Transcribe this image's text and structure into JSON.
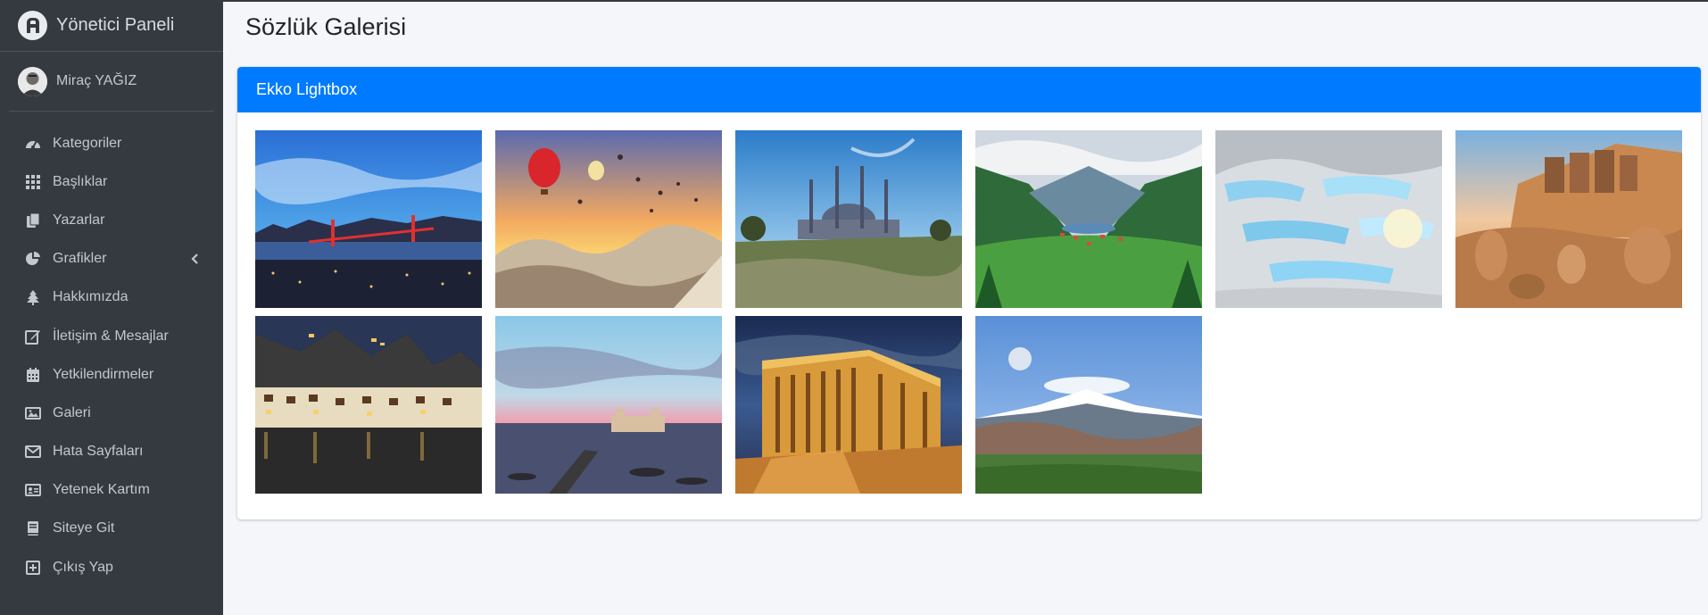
{
  "brand": {
    "title": "Yönetici Paneli"
  },
  "user": {
    "name": "Miraç YAĞIZ"
  },
  "sidebar": {
    "items": [
      {
        "label": "Kategoriler",
        "icon": "tachometer-icon"
      },
      {
        "label": "Başlıklar",
        "icon": "grid-icon"
      },
      {
        "label": "Yazarlar",
        "icon": "copy-icon"
      },
      {
        "label": "Grafikler",
        "icon": "pie-chart-icon",
        "has_arrow": true
      },
      {
        "label": "Hakkımızda",
        "icon": "tree-icon"
      },
      {
        "label": "İletişim & Mesajlar",
        "icon": "edit-icon"
      },
      {
        "label": "Yetkilendirmeler",
        "icon": "calendar-icon"
      },
      {
        "label": "Galeri",
        "icon": "image-icon"
      },
      {
        "label": "Hata Sayfaları",
        "icon": "envelope-icon"
      },
      {
        "label": "Yetenek Kartım",
        "icon": "id-card-icon"
      },
      {
        "label": "Siteye Git",
        "icon": "book-icon"
      },
      {
        "label": "Çıkış Yap",
        "icon": "plus-square-icon"
      }
    ]
  },
  "page": {
    "title": "Sözlük Galerisi"
  },
  "card": {
    "title": "Ekko Lightbox"
  },
  "gallery": {
    "images": [
      {
        "subject": "istanbul-bosphorus-bridge"
      },
      {
        "subject": "cappadocia-balloons"
      },
      {
        "subject": "selimiye-mosque"
      },
      {
        "subject": "uzungol-valley"
      },
      {
        "subject": "pamukkale-travertines"
      },
      {
        "subject": "mount-nemrut-statues"
      },
      {
        "subject": "amasya-houses-night"
      },
      {
        "subject": "kizkalesi-castle-sunset"
      },
      {
        "subject": "anitkabir-night"
      },
      {
        "subject": "mount-ararat-moon"
      }
    ]
  },
  "colors": {
    "sidebar_bg": "#343a40",
    "accent": "#007bff",
    "page_bg": "#f4f6f9"
  }
}
